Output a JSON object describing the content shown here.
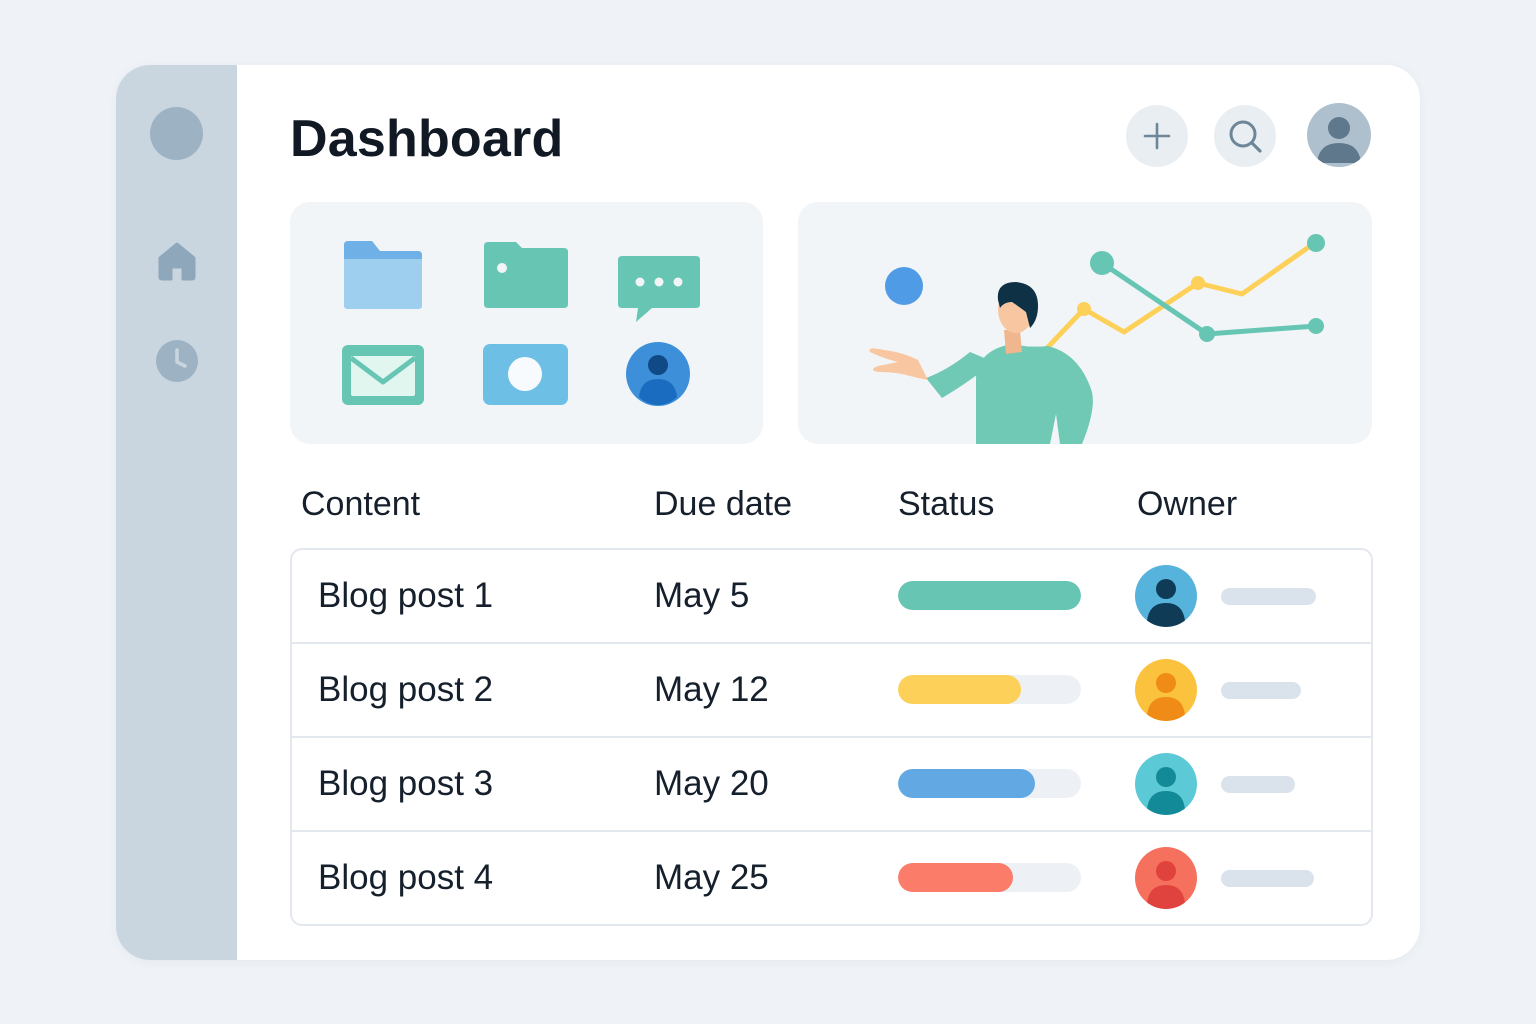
{
  "header": {
    "title": "Dashboard",
    "add_icon": "plus-icon",
    "search_icon": "search-icon",
    "avatar_icon": "user-avatar-icon"
  },
  "sidebar": {
    "items": [
      {
        "icon": "logo-circle"
      },
      {
        "icon": "home-icon"
      },
      {
        "icon": "clock-icon"
      }
    ]
  },
  "quick_apps": [
    {
      "icon": "folder-icon",
      "color": "#9fcfef"
    },
    {
      "icon": "folder-icon",
      "color": "#67c6b3"
    },
    {
      "icon": "chat-bubble-icon",
      "color": "#67c6b3"
    },
    {
      "icon": "mail-icon",
      "color": "#67c6b3"
    },
    {
      "icon": "photo-icon",
      "color": "#6ebfe6"
    },
    {
      "icon": "user-icon",
      "color": "#3d8fda"
    }
  ],
  "table": {
    "headers": {
      "content": "Content",
      "due_date": "Due date",
      "status": "Status",
      "owner": "Owner"
    },
    "rows": [
      {
        "content": "Blog post 1",
        "due": "May 5",
        "progress": 1.0,
        "color": "#67c6b3",
        "avatar_bg": "#56b4dc",
        "avatar_fg": "#0f3b57"
      },
      {
        "content": "Blog post 2",
        "due": "May 12",
        "progress": 0.67,
        "color": "#fdd05a",
        "avatar_bg": "#fbc33d",
        "avatar_fg": "#f08b18"
      },
      {
        "content": "Blog post 3",
        "due": "May 20",
        "progress": 0.75,
        "color": "#62a8e3",
        "avatar_bg": "#5ccad6",
        "avatar_fg": "#138a97"
      },
      {
        "content": "Blog post 4",
        "due": "May 25",
        "progress": 0.63,
        "color": "#fb7c69",
        "avatar_bg": "#f6705e",
        "avatar_fg": "#e0433d"
      }
    ]
  },
  "colors": {
    "sidebar": "#c9d6e0",
    "background": "#eff3f7",
    "card": "#f2f5f8"
  }
}
